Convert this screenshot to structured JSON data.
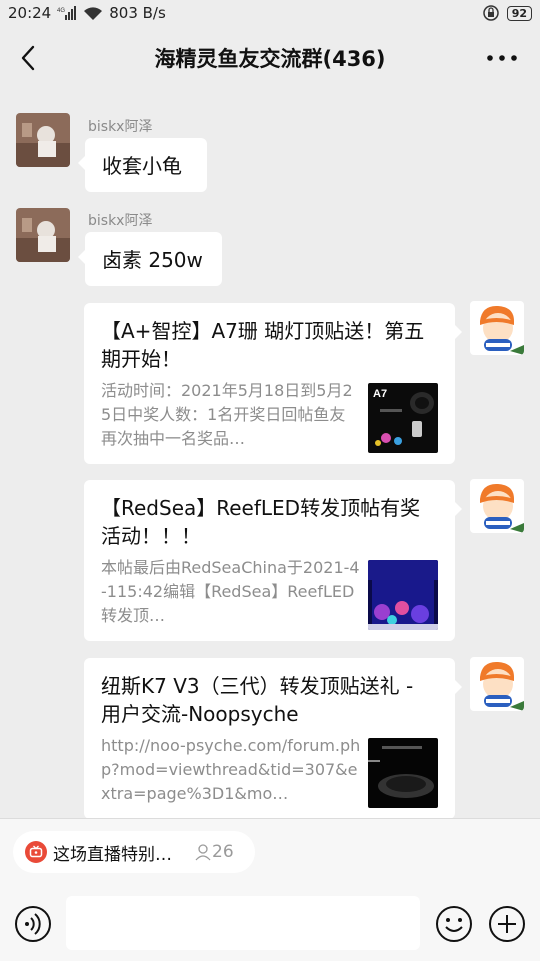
{
  "status_bar": {
    "time": "20:24",
    "network": "803 B/s",
    "battery": "92"
  },
  "header": {
    "title": "海精灵鱼友交流群(436)"
  },
  "messages": [
    {
      "sender": "biskx阿泽",
      "text": "收套小龟"
    },
    {
      "sender": "biskx阿泽",
      "text": "卤素 250w"
    }
  ],
  "cards": [
    {
      "title": "【A+智控】A7珊 瑚灯顶贴送！第五期开始！",
      "desc": "活动时间：2021年5月18日到5月25日中奖人数：1名开奖日回帖鱼友再次抽中一名奖品…",
      "thumb_label": "A7"
    },
    {
      "title": "【RedSea】ReefLED转发顶帖有奖活动！！！",
      "desc": "本帖最后由RedSeaChina于2021-4-115:42编辑【RedSea】ReefLED转发顶…"
    },
    {
      "title": "纽斯K7 V3（三代）转发顶贴送礼 - 用户交流-Noopsyche",
      "desc": "http://noo-psyche.com/forum.php?mod=viewthread&tid=307&extra=page%3D1&mo…"
    }
  ],
  "live_bar": {
    "text": "这场直播特别…",
    "viewers": "26"
  },
  "icons": {
    "back": "chevron-left-icon",
    "more": "more-dots-icon",
    "voice": "voice-icon",
    "emoji": "emoji-icon",
    "plus": "plus-icon",
    "live": "live-tv-icon",
    "viewer": "person-icon"
  },
  "colors": {
    "background": "#ededed",
    "live_icon": "#e94a38",
    "muted_text": "#8d8d8d"
  }
}
